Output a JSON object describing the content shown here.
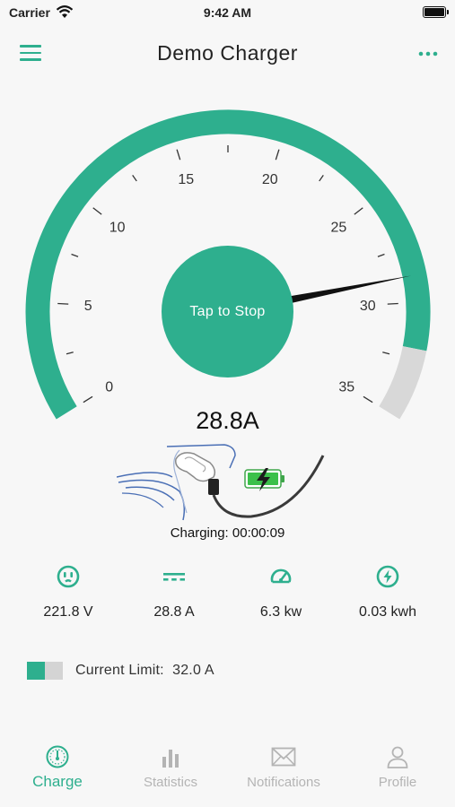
{
  "status": {
    "carrier": "Carrier",
    "time": "9:42 AM"
  },
  "header": {
    "title": "Demo Charger",
    "menu_icon": "hamburger-icon",
    "more_icon": "more-dots-icon"
  },
  "gauge": {
    "ticks": [
      "0",
      "5",
      "10",
      "15",
      "20",
      "25",
      "30",
      "35"
    ],
    "min": 0,
    "max": 35,
    "value": 28.8,
    "limit": 32.0,
    "accent_color": "#2eaf8e",
    "track_color": "#d8d8d8"
  },
  "tap_button": {
    "label": "Tap to Stop"
  },
  "reading": "28.8A",
  "charging_time": "Charging: 00:00:09",
  "stats": [
    {
      "icon": "outlet-icon",
      "value": "221.8 V"
    },
    {
      "icon": "dc-current-icon",
      "value": "28.8 A"
    },
    {
      "icon": "speedometer-icon",
      "value": "6.3 kw"
    },
    {
      "icon": "bolt-icon",
      "value": "0.03 kwh"
    }
  ],
  "current_limit": {
    "label": "Current Limit:",
    "value": "32.0 A",
    "label_full": "Current Limit:  32.0 A"
  },
  "tabs": [
    {
      "label": "Charge",
      "icon": "gauge-tab-icon",
      "active": true
    },
    {
      "label": "Statistics",
      "icon": "bar-chart-icon",
      "active": false
    },
    {
      "label": "Notifications",
      "icon": "envelope-icon",
      "active": false
    },
    {
      "label": "Profile",
      "icon": "user-icon",
      "active": false
    }
  ]
}
